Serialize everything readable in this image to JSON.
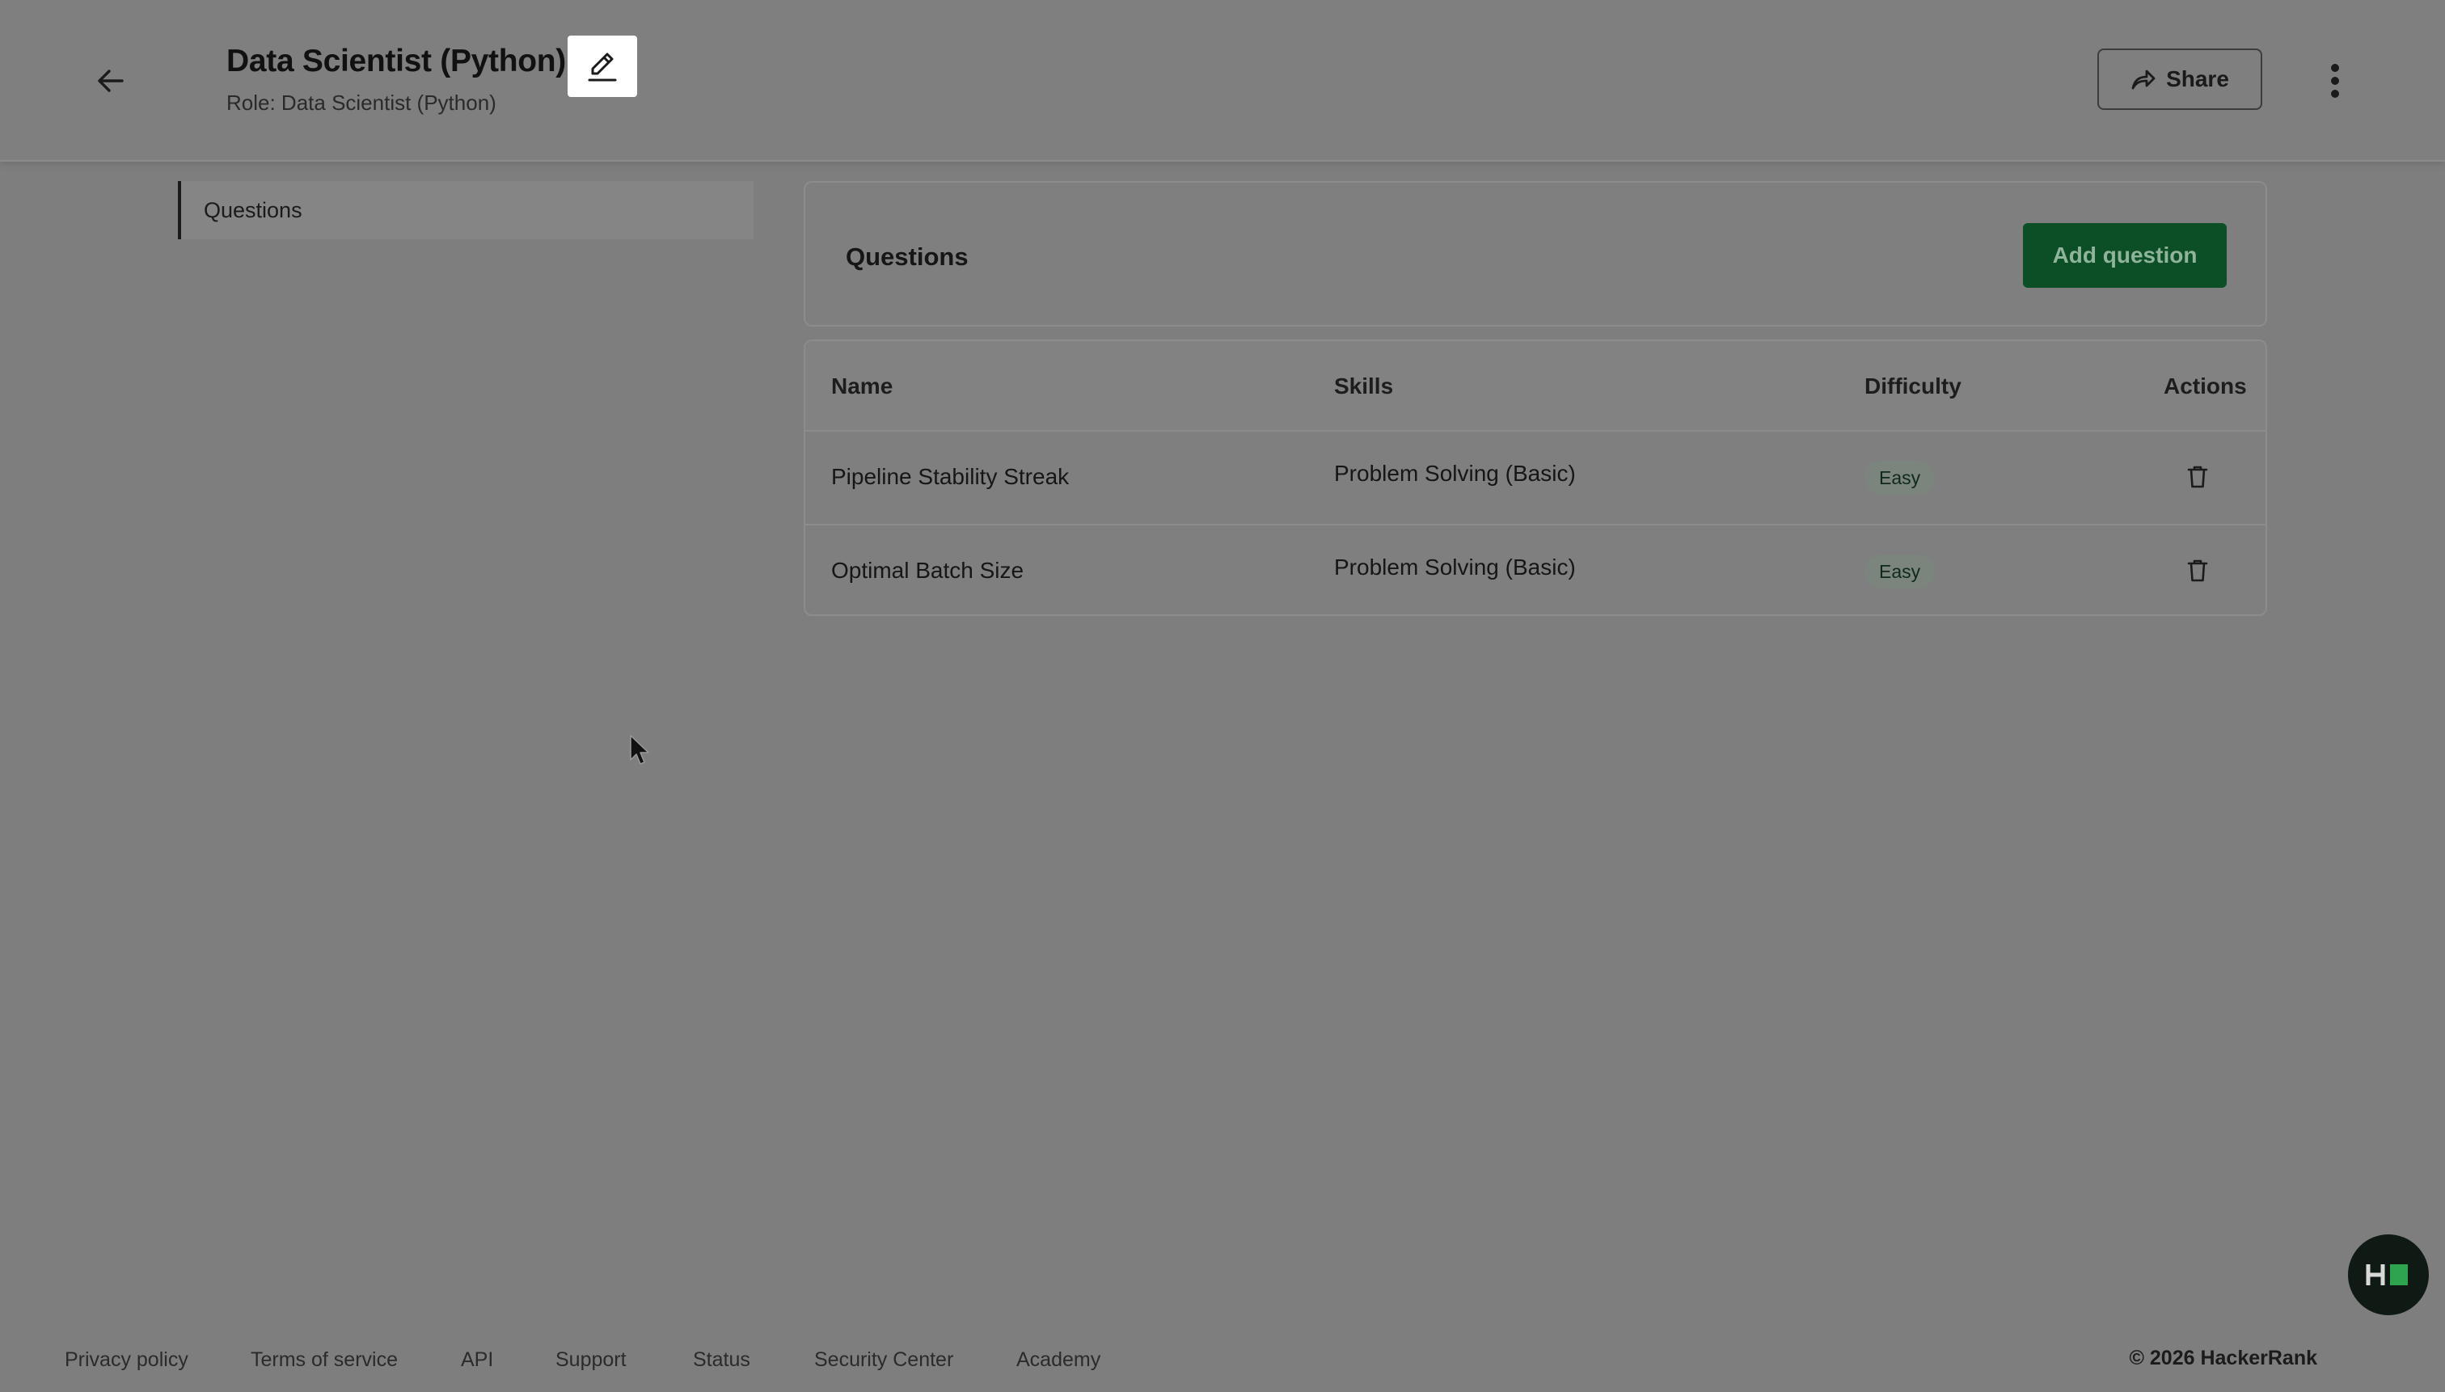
{
  "header": {
    "title": "Data Scientist (Python)",
    "subtitle": "Role: Data Scientist (Python)",
    "share_label": "Share"
  },
  "sidebar": {
    "items": [
      {
        "label": "Questions",
        "active": true
      }
    ]
  },
  "questions_panel": {
    "title": "Questions",
    "add_button_label": "Add question"
  },
  "table": {
    "columns": [
      "Name",
      "Skills",
      "Difficulty",
      "Actions"
    ],
    "rows": [
      {
        "name": "Pipeline Stability Streak",
        "skills": "Problem Solving (Basic)",
        "difficulty": "Easy"
      },
      {
        "name": "Optimal Batch Size",
        "skills": "Problem Solving (Basic)",
        "difficulty": "Easy"
      }
    ]
  },
  "footer": {
    "links": [
      "Privacy policy",
      "Terms of service",
      "API",
      "Support",
      "Status",
      "Security Center",
      "Academy"
    ],
    "copyright": "© 2026 HackerRank"
  },
  "icons": {
    "back": "arrow-left-icon",
    "edit": "pencil-icon",
    "share": "share-arrow-icon",
    "more": "kebab-menu-icon",
    "delete": "trash-icon",
    "chat": "hackerrank-logo-icon"
  },
  "colors": {
    "primary_button": "#0c4e25",
    "overlay_background": "#7e7e7e",
    "chat_bubble": "#0f1a14",
    "logo_accent": "#2ea44f"
  }
}
